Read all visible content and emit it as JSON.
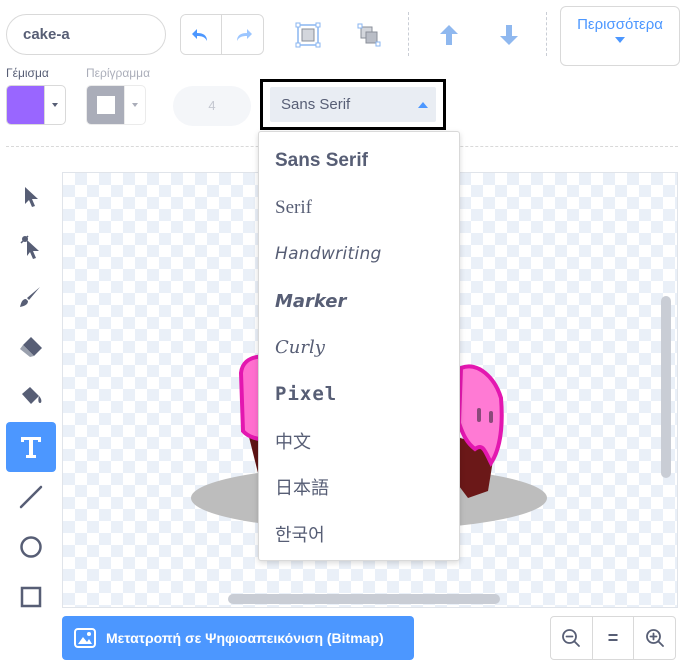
{
  "costume": {
    "name": "cake-a"
  },
  "toolbar_top": {
    "more_label": "Περισσότερα"
  },
  "fill": {
    "label": "Γέμισμα",
    "color": "#9966ff"
  },
  "outline": {
    "label": "Περίγραμμα",
    "color": "#ffffff"
  },
  "stroke_width": "4",
  "font": {
    "selected": "Sans Serif",
    "options": [
      "Sans Serif",
      "Serif",
      "Handwriting",
      "Marker",
      "Curly",
      "Pixel",
      "中文",
      "日本語",
      "한국어"
    ]
  },
  "bottom": {
    "bitmap_label": "Μετατροπή σε Ψηφιοαπεικόνιση (Bitmap)",
    "zoom_reset": "="
  },
  "colors": {
    "accent": "#4c97ff",
    "text": "#575e75",
    "icing": "#ff66cc",
    "cake": "#6b1818",
    "plate": "#bdbdbd"
  }
}
